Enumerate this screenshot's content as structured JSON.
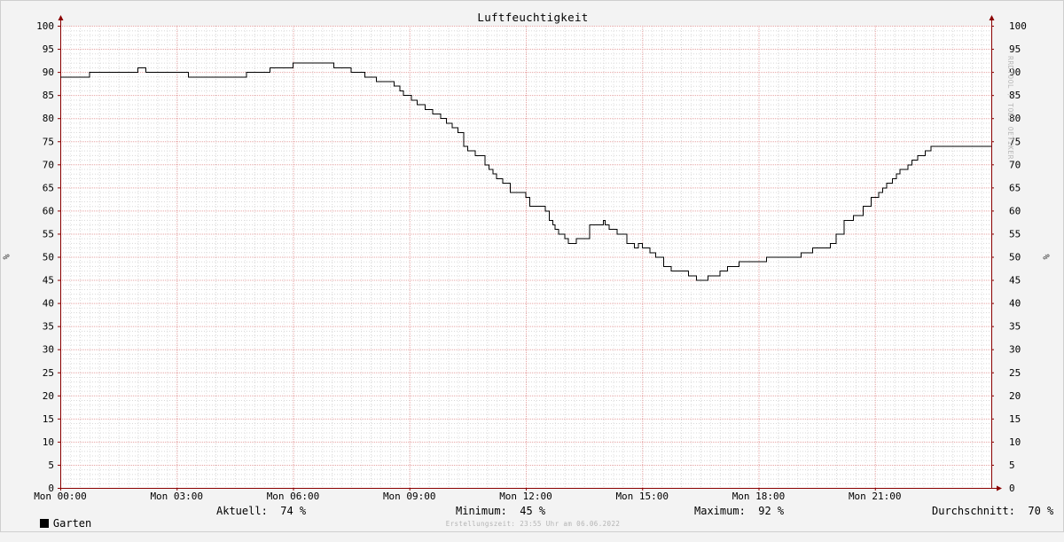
{
  "chart_data": {
    "type": "line",
    "title": "Luftfeuchtigkeit",
    "ylabel": "%",
    "ylim": [
      0,
      100
    ],
    "y_ticks": [
      0,
      5,
      10,
      15,
      20,
      25,
      30,
      35,
      40,
      45,
      50,
      55,
      60,
      65,
      70,
      75,
      80,
      85,
      90,
      95,
      100
    ],
    "x_ticks": [
      {
        "label": "Mon 00:00",
        "hour": 0
      },
      {
        "label": "Mon 03:00",
        "hour": 3
      },
      {
        "label": "Mon 06:00",
        "hour": 6
      },
      {
        "label": "Mon 09:00",
        "hour": 9
      },
      {
        "label": "Mon 12:00",
        "hour": 12
      },
      {
        "label": "Mon 15:00",
        "hour": 15
      },
      {
        "label": "Mon 18:00",
        "hour": 18
      },
      {
        "label": "Mon 21:00",
        "hour": 21
      }
    ],
    "grid": true,
    "legend": "bottom-left",
    "line_color": "#000000",
    "grid_minor_color": "#d8d8d8",
    "grid_major_color": "#e6a3a3",
    "axis_color": "#8a0000",
    "series": [
      {
        "name": "Garten",
        "step": true,
        "x": [
          0,
          0.75,
          2,
          2.05,
          2.2,
          3.3,
          4.8,
          5.4,
          6.0,
          7.05,
          7.5,
          7.85,
          8.15,
          8.6,
          8.75,
          8.85,
          9.05,
          9.2,
          9.4,
          9.6,
          9.8,
          9.95,
          10.1,
          10.25,
          10.4,
          10.5,
          10.7,
          10.95,
          11.05,
          11.15,
          11.25,
          11.4,
          11.6,
          12.0,
          12.1,
          12.5,
          12.6,
          12.7,
          12.75,
          12.85,
          13.0,
          13.1,
          13.3,
          13.5,
          13.65,
          14.0,
          14.05,
          14.15,
          14.35,
          14.6,
          14.8,
          14.9,
          15.0,
          15.2,
          15.35,
          15.45,
          15.55,
          15.75,
          16.2,
          16.4,
          16.7,
          17.0,
          17.2,
          17.5,
          18.2,
          19.1,
          19.4,
          19.85,
          20.0,
          20.2,
          20.45,
          20.7,
          20.9,
          21.1,
          21.2,
          21.3,
          21.45,
          21.55,
          21.65,
          21.85,
          21.95,
          22.1,
          22.3,
          22.45,
          22.6,
          22.9,
          23.4,
          23.7,
          23.98
        ],
        "y": [
          89,
          90,
          91,
          91,
          90,
          89,
          90,
          91,
          92,
          91,
          90,
          89,
          88,
          87,
          86,
          85,
          84,
          83,
          82,
          81,
          80,
          79,
          78,
          77,
          74,
          73,
          72,
          70,
          69,
          68,
          67,
          66,
          64,
          63,
          61,
          60,
          58,
          57,
          56,
          55,
          54,
          53,
          54,
          54,
          57,
          58,
          57,
          56,
          55,
          53,
          52,
          53,
          52,
          51,
          50,
          50,
          48,
          47,
          46,
          45,
          46,
          47,
          48,
          49,
          50,
          51,
          52,
          53,
          55,
          58,
          59,
          61,
          63,
          64,
          65,
          66,
          67,
          68,
          69,
          70,
          71,
          72,
          73,
          74,
          74,
          74,
          74,
          74,
          74
        ]
      }
    ]
  },
  "legend": {
    "series_name": "Garten",
    "current_label": "Aktuell:",
    "current_value": "74 %",
    "min_label": "Minimum:",
    "min_value": "45 %",
    "max_label": "Maximum:",
    "max_value": "92 %",
    "avg_label": "Durchschnitt:",
    "avg_value": "70 %"
  },
  "watermark": "RRDTOOL / TOBI OETIKER",
  "footer": "Erstellungszeit: 23:55 Uhr am 06.06.2022"
}
